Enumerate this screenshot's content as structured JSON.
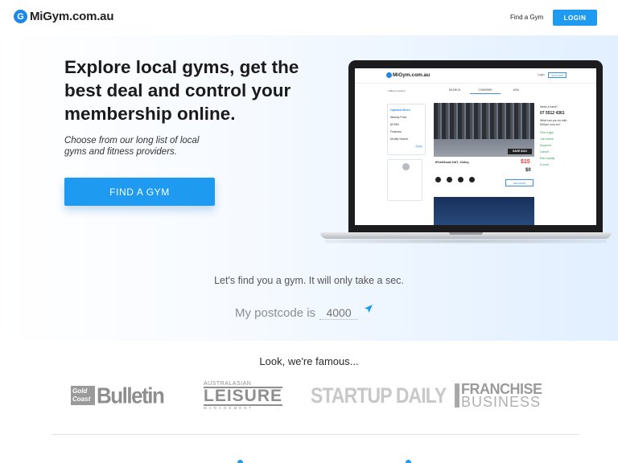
{
  "header": {
    "logo_mark": "G",
    "logo_text": "MiGym.com.au",
    "nav_find": "Find a Gym",
    "login_label": "LOGIN"
  },
  "hero": {
    "title": "Explore local gyms, get the best deal and control your membership online.",
    "subtitle": "Choose from our long list of local gyms and fitness providers.",
    "cta_label": "FIND A GYM",
    "find_text": "Let's find you a gym. It will only take a sec.",
    "postcode_label": "My postcode is",
    "postcode_placeholder": "4000"
  },
  "laptop_screen": {
    "logo_text": "MiGym.com.au",
    "login": "Login",
    "join": "JOIN NOW",
    "back": "< Back to search",
    "tabs": [
      "SEARCH",
      "COMPARE",
      "JOIN"
    ],
    "filters": {
      "title": "Optional filters",
      "items": [
        "Weekly Price",
        "$0        $99",
        "Features",
        "Modify Search",
        "Apply"
      ]
    },
    "save_badge": "SAVE $101",
    "gym_name": "iFeelGood 24/7, Oxley",
    "price_main": "$15",
    "price_alt": "$0",
    "see_more": "SEE MORE",
    "side": {
      "help": "Need a hand?",
      "phone": "07 5512 4361",
      "why": "What can you do with MiGym.com.au?",
      "checks": [
        "Find a gym",
        "Join online",
        "Suspend",
        "Cancel",
        "Earn loyalty",
        "& more"
      ]
    }
  },
  "famous": {
    "title": "Look, we're famous...",
    "bulletin_box": "Gold Coast",
    "bulletin_word": "Bulletin",
    "leisure_top": "AUSTRALASIAN",
    "leisure_word": "LEISURE",
    "leisure_bottom": "MANAGEMENT",
    "startup": "STARTUP DAILY",
    "franchise_1": "FRANCHISE",
    "franchise_2": "BUSINESS"
  },
  "colors": {
    "accent": "#1e9bf0",
    "brand_blue": "#1e88e5",
    "price_red": "#e53935"
  },
  "icons": [
    "logo-mark-icon",
    "send-arrow-icon"
  ]
}
